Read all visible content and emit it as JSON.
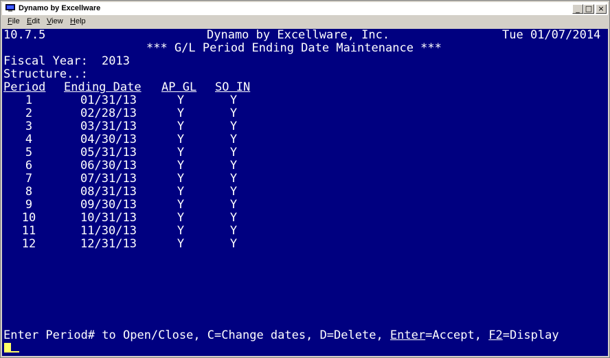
{
  "window": {
    "title": "Dynamo by Excellware",
    "controls": {
      "minimize": "_",
      "maximize": "□",
      "close": "×"
    }
  },
  "menu": [
    {
      "label": "File",
      "hotkey": "F",
      "rest": "ile"
    },
    {
      "label": "Edit",
      "hotkey": "E",
      "rest": "dit"
    },
    {
      "label": "View",
      "hotkey": "V",
      "rest": "iew"
    },
    {
      "label": "Help",
      "hotkey": "H",
      "rest": "elp"
    }
  ],
  "screen": {
    "version": "10.7.5",
    "company": "Dynamo by Excellware, Inc.",
    "date": "Tue 01/07/2014",
    "heading": "*** G/L Period Ending Date Maintenance ***",
    "fiscal_year_label": "Fiscal Year:",
    "fiscal_year": "2013",
    "structure_label": "Structure..:",
    "columns": {
      "period": "Period",
      "ending_date": "Ending Date",
      "ap_gl": "AP GL",
      "so_in": "SO IN"
    },
    "rows": [
      {
        "period": "1",
        "ending_date": "01/31/13",
        "ap_gl": "Y",
        "so_in": "Y"
      },
      {
        "period": "2",
        "ending_date": "02/28/13",
        "ap_gl": "Y",
        "so_in": "Y"
      },
      {
        "period": "3",
        "ending_date": "03/31/13",
        "ap_gl": "Y",
        "so_in": "Y"
      },
      {
        "period": "4",
        "ending_date": "04/30/13",
        "ap_gl": "Y",
        "so_in": "Y"
      },
      {
        "period": "5",
        "ending_date": "05/31/13",
        "ap_gl": "Y",
        "so_in": "Y"
      },
      {
        "period": "6",
        "ending_date": "06/30/13",
        "ap_gl": "Y",
        "so_in": "Y"
      },
      {
        "period": "7",
        "ending_date": "07/31/13",
        "ap_gl": "Y",
        "so_in": "Y"
      },
      {
        "period": "8",
        "ending_date": "08/31/13",
        "ap_gl": "Y",
        "so_in": "Y"
      },
      {
        "period": "9",
        "ending_date": "09/30/13",
        "ap_gl": "Y",
        "so_in": "Y"
      },
      {
        "period": "10",
        "ending_date": "10/31/13",
        "ap_gl": "Y",
        "so_in": "Y"
      },
      {
        "period": "11",
        "ending_date": "11/30/13",
        "ap_gl": "Y",
        "so_in": "Y"
      },
      {
        "period": "12",
        "ending_date": "12/31/13",
        "ap_gl": "Y",
        "so_in": "Y"
      }
    ],
    "prompt": {
      "text1": "Enter Period# to Open/Close, C=Change dates, D=Delete, ",
      "enter_key": "Enter",
      "text2": "=Accept, ",
      "f2_key": "F2",
      "text3": "=Display"
    }
  },
  "colors": {
    "screen_bg": "#000080",
    "screen_fg": "#ffffff",
    "cursor": "#ffff66"
  }
}
